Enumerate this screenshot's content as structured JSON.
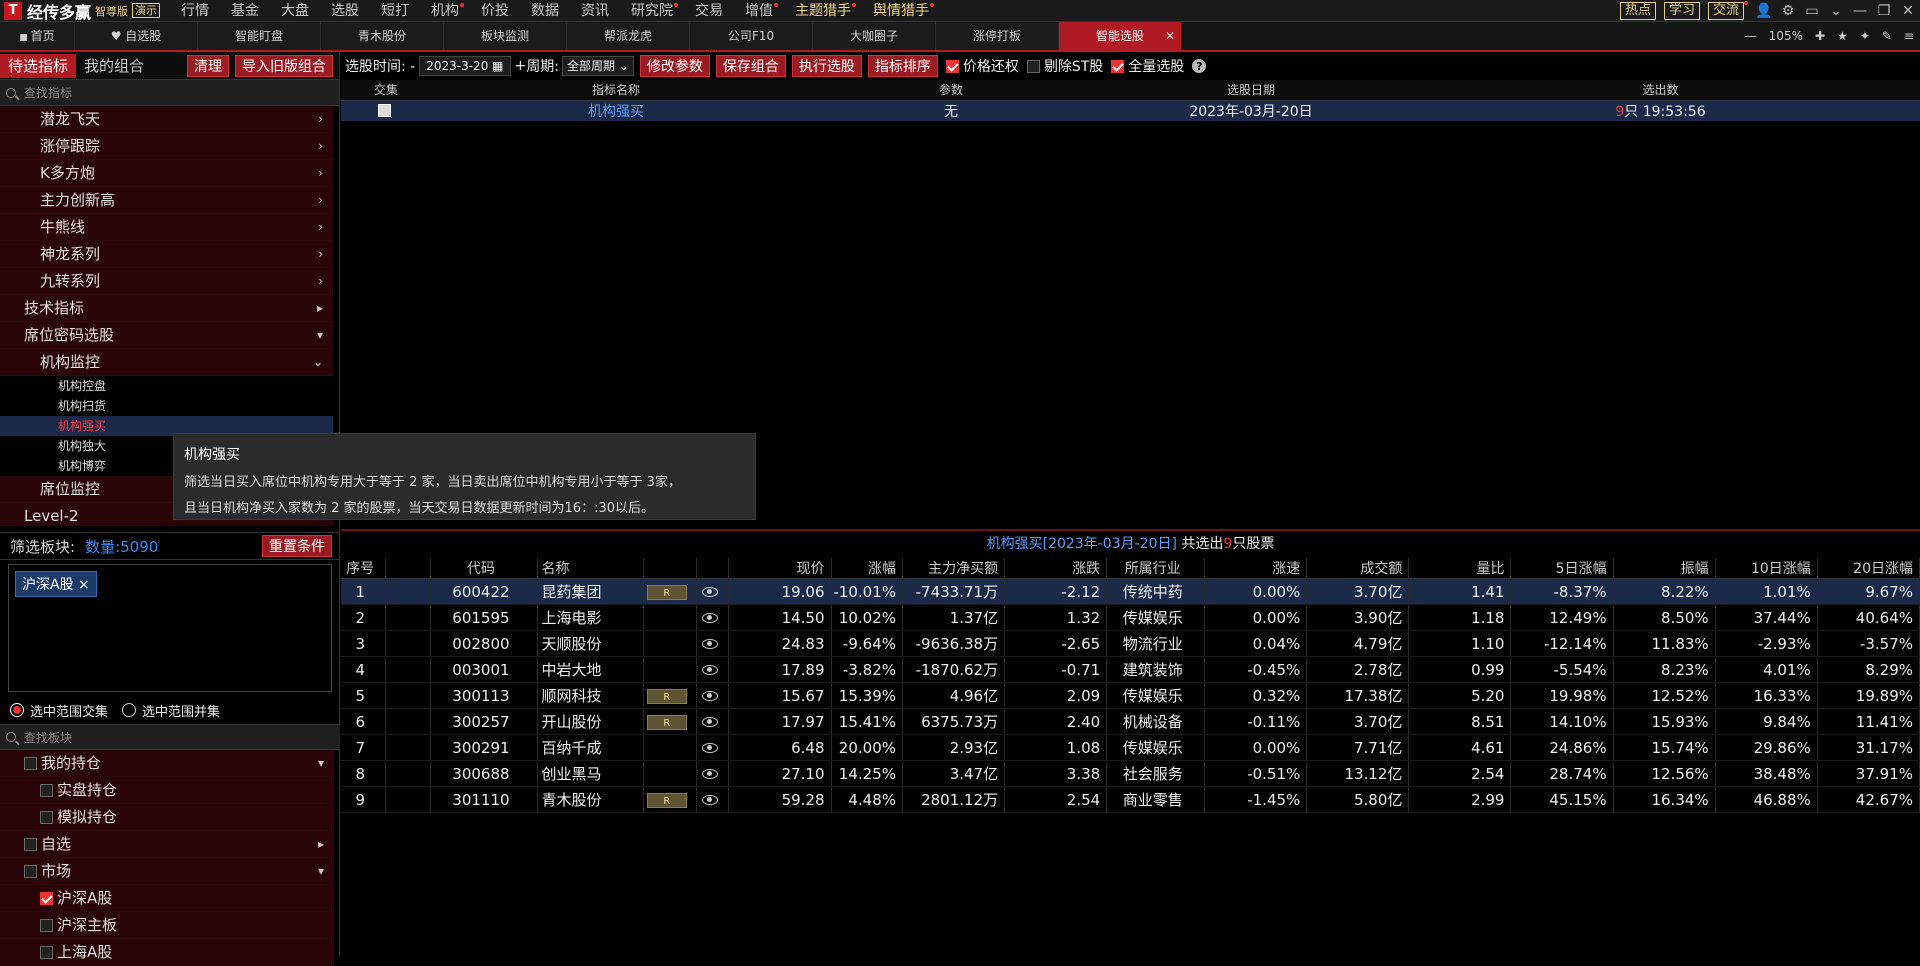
{
  "app": {
    "logo": "T",
    "title": "经传多赢",
    "edition": "智尊版",
    "demo": "演示"
  },
  "menu": [
    {
      "label": "行情",
      "dot": false
    },
    {
      "label": "基金",
      "dot": false
    },
    {
      "label": "大盘",
      "dot": false
    },
    {
      "label": "选股",
      "dot": false
    },
    {
      "label": "短打",
      "dot": false
    },
    {
      "label": "机构",
      "dot": true
    },
    {
      "label": "价投",
      "dot": false
    },
    {
      "label": "数据",
      "dot": false
    },
    {
      "label": "资讯",
      "dot": false
    },
    {
      "label": "研究院",
      "dot": true
    },
    {
      "label": "交易",
      "dot": false
    },
    {
      "label": "增值",
      "dot": true
    },
    {
      "label": "主题猎手",
      "dot": true,
      "gold": true
    },
    {
      "label": "舆情猎手",
      "dot": true,
      "gold": true
    }
  ],
  "topright": {
    "hot": "热点",
    "learn": "学习",
    "chat": "交流"
  },
  "tabs": [
    {
      "label": "首页"
    },
    {
      "label": "自选股"
    },
    {
      "label": "智能盯盘"
    },
    {
      "label": "青木股份"
    },
    {
      "label": "板块监测"
    },
    {
      "label": "帮派龙虎"
    },
    {
      "label": "公司F10"
    },
    {
      "label": "大咖圈子"
    },
    {
      "label": "涨停打板"
    },
    {
      "label": "智能选股",
      "active": true
    }
  ],
  "zoom": "105%",
  "left": {
    "tab1": "待选指标",
    "tab2": "我的组合",
    "clear": "清理",
    "import": "导入旧版组合",
    "search_ph": "查找指标",
    "tree": [
      {
        "label": "潜龙飞天",
        "lvl": "l2",
        "arr": "›"
      },
      {
        "label": "涨停跟踪",
        "lvl": "l2",
        "arr": "›"
      },
      {
        "label": "K多方炮",
        "lvl": "l2",
        "arr": "›"
      },
      {
        "label": "主力创新高",
        "lvl": "l2",
        "arr": "›"
      },
      {
        "label": "牛熊线",
        "lvl": "l2",
        "arr": "›"
      },
      {
        "label": "神龙系列",
        "lvl": "l2",
        "arr": "›"
      },
      {
        "label": "九转系列",
        "lvl": "l2",
        "arr": "›"
      },
      {
        "label": "技术指标",
        "lvl": "l1",
        "arr": "▸"
      },
      {
        "label": "席位密码选股",
        "lvl": "l1",
        "arr": "▾"
      },
      {
        "label": "机构监控",
        "lvl": "l2",
        "arr": "⌄"
      },
      {
        "label": "机构控盘",
        "lvl": "l3",
        "arr": ""
      },
      {
        "label": "机构扫货",
        "lvl": "l3",
        "arr": ""
      },
      {
        "label": "机构强买",
        "lvl": "l3",
        "arr": "",
        "sel": true
      },
      {
        "label": "机构独大",
        "lvl": "l3",
        "arr": ""
      },
      {
        "label": "机构博弈",
        "lvl": "l3",
        "arr": ""
      },
      {
        "label": "席位监控",
        "lvl": "l2",
        "arr": ""
      },
      {
        "label": "Level-2",
        "lvl": "l1",
        "arr": ""
      }
    ],
    "tooltip": {
      "title": "机构强买",
      "line1": "筛选当日买入席位中机构专用大于等于 2 家，当日卖出席位中机构专用小于等于 3家，",
      "line2": "且当日机构净买入家数为 2 家的股票，当天交易日数据更新时间为16：:30以后。"
    },
    "filter": {
      "label": "筛选板块:",
      "count": "数量:5090",
      "reset": "重置条件",
      "chip": "沪深A股",
      "chip_x": "×",
      "r1": "选中范围交集",
      "r2": "选中范围并集",
      "search_ph": "查找板块"
    },
    "btree": [
      {
        "label": "我的持仓",
        "lvl": "l1",
        "arr": "▾",
        "cb": true
      },
      {
        "label": "实盘持仓",
        "lvl": "l2",
        "arr": "",
        "cb": true
      },
      {
        "label": "模拟持仓",
        "lvl": "l2",
        "arr": "",
        "cb": true
      },
      {
        "label": "自选",
        "lvl": "l1",
        "arr": "▸",
        "cb": true
      },
      {
        "label": "市场",
        "lvl": "l1",
        "arr": "▾",
        "cb": true
      },
      {
        "label": "沪深A股",
        "lvl": "l2",
        "arr": "",
        "cb": true,
        "on": true
      },
      {
        "label": "沪深主板",
        "lvl": "l2",
        "arr": "",
        "cb": true
      },
      {
        "label": "上海A股",
        "lvl": "l2",
        "arr": "",
        "cb": true
      }
    ]
  },
  "toolbar": {
    "time_label": "选股时间: -",
    "date": "2023-3-20",
    "plus": "+",
    "period_label": "周期:",
    "period": "全部周期",
    "modify": "修改参数",
    "save": "保存组合",
    "run": "执行选股",
    "sort": "指标排序",
    "c1": "价格还权",
    "c2": "剔除ST股",
    "c3": "全量选股"
  },
  "upper": {
    "headers": [
      "交集",
      "指标名称",
      "参数",
      "选股日期",
      "选出数"
    ],
    "row": {
      "name": "机构强买",
      "param": "无",
      "date": "2023年-03月-20日",
      "count": "9",
      "count_suffix": "只 19:53:56"
    }
  },
  "result": {
    "name": "机构强买[2023年-03月-20日]",
    "mid": " 共选出",
    "count": "9",
    "suffix": "只股票"
  },
  "columns": [
    "序号",
    "",
    "代码",
    "名称",
    "",
    "",
    "现价",
    "涨幅",
    "主力净买额",
    "涨跌",
    "所属行业",
    "涨速",
    "成交额",
    "量比",
    "5日涨幅",
    "振幅",
    "10日涨幅",
    "20日涨幅"
  ],
  "stocks": [
    {
      "n": "1",
      "code": "600422",
      "name": "昆药集团",
      "r": true,
      "price": "19.06",
      "pct": "-10.01%",
      "net": "-7433.71万",
      "chg": "-2.12",
      "ind": "传统中药",
      "spd": "0.00%",
      "amt": "3.70亿",
      "vr": "1.41",
      "d5": "-8.37%",
      "amp": "8.22%",
      "d10": "1.01%",
      "d20": "9.67%",
      "cls": {
        "price": "dn",
        "pct": "dn",
        "net": "dn",
        "chg": "dn",
        "spd": "wt",
        "d5": "dn",
        "d10": "up",
        "d20": "up"
      }
    },
    {
      "n": "2",
      "code": "601595",
      "name": "上海电影",
      "r": false,
      "price": "14.50",
      "pct": "10.02%",
      "net": "1.37亿",
      "chg": "1.32",
      "ind": "传媒娱乐",
      "spd": "0.00%",
      "amt": "3.90亿",
      "vr": "1.18",
      "d5": "12.49%",
      "amp": "8.50%",
      "d10": "37.44%",
      "d20": "40.64%",
      "cls": {
        "price": "up",
        "pct": "up",
        "net": "up",
        "chg": "up",
        "spd": "wt",
        "d5": "up",
        "d10": "up",
        "d20": "up"
      }
    },
    {
      "n": "3",
      "code": "002800",
      "name": "天顺股份",
      "r": false,
      "price": "24.83",
      "pct": "-9.64%",
      "net": "-9636.38万",
      "chg": "-2.65",
      "ind": "物流行业",
      "spd": "0.04%",
      "amt": "4.79亿",
      "vr": "1.10",
      "d5": "-12.14%",
      "amp": "11.83%",
      "d10": "-2.93%",
      "d20": "-3.57%",
      "cls": {
        "price": "dn",
        "pct": "dn",
        "net": "dn",
        "chg": "dn",
        "spd": "up",
        "d5": "dn",
        "d10": "dn",
        "d20": "dn"
      }
    },
    {
      "n": "4",
      "code": "003001",
      "name": "中岩大地",
      "r": false,
      "price": "17.89",
      "pct": "-3.82%",
      "net": "-1870.62万",
      "chg": "-0.71",
      "ind": "建筑装饰",
      "spd": "-0.45%",
      "amt": "2.78亿",
      "vr": "0.99",
      "d5": "-5.54%",
      "amp": "8.23%",
      "d10": "4.01%",
      "d20": "8.29%",
      "cls": {
        "price": "dn",
        "pct": "dn",
        "net": "dn",
        "chg": "dn",
        "spd": "dn",
        "d5": "dn",
        "d10": "up",
        "d20": "up"
      }
    },
    {
      "n": "5",
      "code": "300113",
      "name": "顺网科技",
      "r": true,
      "price": "15.67",
      "pct": "15.39%",
      "net": "4.96亿",
      "chg": "2.09",
      "ind": "传媒娱乐",
      "spd": "0.32%",
      "amt": "17.38亿",
      "vr": "5.20",
      "d5": "19.98%",
      "amp": "12.52%",
      "d10": "16.33%",
      "d20": "19.89%",
      "cls": {
        "price": "up",
        "pct": "up",
        "net": "up",
        "chg": "up",
        "spd": "up",
        "d5": "up",
        "d10": "up",
        "d20": "up"
      }
    },
    {
      "n": "6",
      "code": "300257",
      "name": "开山股份",
      "r": true,
      "price": "17.97",
      "pct": "15.41%",
      "net": "6375.73万",
      "chg": "2.40",
      "ind": "机械设备",
      "spd": "-0.11%",
      "amt": "3.70亿",
      "vr": "8.51",
      "d5": "14.10%",
      "amp": "15.93%",
      "d10": "9.84%",
      "d20": "11.41%",
      "cls": {
        "price": "up",
        "pct": "up",
        "net": "up",
        "chg": "up",
        "spd": "dn",
        "d5": "up",
        "d10": "up",
        "d20": "up"
      }
    },
    {
      "n": "7",
      "code": "300291",
      "name": "百纳千成",
      "r": false,
      "price": "6.48",
      "pct": "20.00%",
      "net": "2.93亿",
      "chg": "1.08",
      "ind": "传媒娱乐",
      "spd": "0.00%",
      "amt": "7.71亿",
      "vr": "4.61",
      "d5": "24.86%",
      "amp": "15.74%",
      "d10": "29.86%",
      "d20": "31.17%",
      "cls": {
        "price": "up",
        "pct": "up",
        "net": "up",
        "chg": "up",
        "spd": "wt",
        "d5": "up",
        "d10": "up",
        "d20": "up"
      }
    },
    {
      "n": "8",
      "code": "300688",
      "name": "创业黑马",
      "r": false,
      "price": "27.10",
      "pct": "14.25%",
      "net": "3.47亿",
      "chg": "3.38",
      "ind": "社会服务",
      "spd": "-0.51%",
      "amt": "13.12亿",
      "vr": "2.54",
      "d5": "28.74%",
      "amp": "12.56%",
      "d10": "38.48%",
      "d20": "37.91%",
      "cls": {
        "price": "up",
        "pct": "up",
        "net": "up",
        "chg": "up",
        "spd": "dn",
        "d5": "up",
        "d10": "up",
        "d20": "up"
      }
    },
    {
      "n": "9",
      "code": "301110",
      "name": "青木股份",
      "r": true,
      "price": "59.28",
      "pct": "4.48%",
      "net": "2801.12万",
      "chg": "2.54",
      "ind": "商业零售",
      "spd": "-1.45%",
      "amt": "5.80亿",
      "vr": "2.99",
      "d5": "45.15%",
      "amp": "16.34%",
      "d10": "46.88%",
      "d20": "42.67%",
      "cls": {
        "price": "up",
        "pct": "up",
        "net": "up",
        "chg": "up",
        "spd": "dn",
        "d5": "up",
        "d10": "up",
        "d20": "up"
      }
    }
  ],
  "r_badge": "R",
  "colors": {
    "accent": "#b01a22",
    "up": "#ff3d3d",
    "down": "#2ed341",
    "link": "#29c4f1",
    "industry": "#f2d58a",
    "selected_row": "#1c2a4a"
  }
}
